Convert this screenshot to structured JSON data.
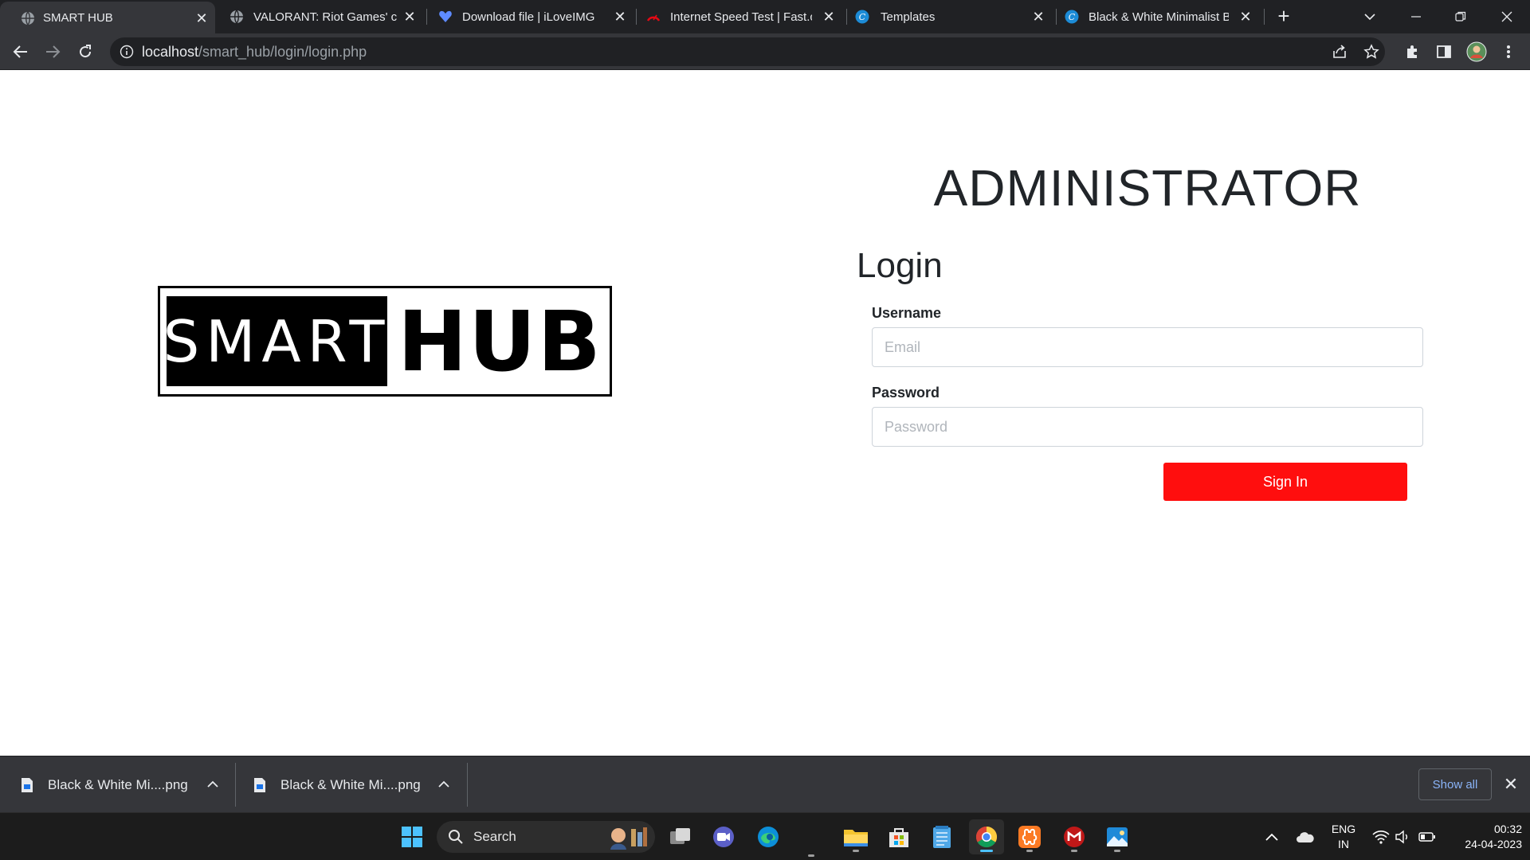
{
  "browser": {
    "tabs": [
      {
        "title": "SMART HUB",
        "active": true
      },
      {
        "title": "VALORANT: Riot Games' co"
      },
      {
        "title": "Download file | iLoveIMG"
      },
      {
        "title": "Internet Speed Test | Fast.co"
      },
      {
        "title": "Templates"
      },
      {
        "title": "Black & White Minimalist B"
      }
    ],
    "address": {
      "host": "localhost",
      "path": "/smart_hub/login/login.php"
    }
  },
  "page": {
    "logo": {
      "left_text": "SMART",
      "right_text": "HUB"
    },
    "admin_heading": "ADMINISTRATOR",
    "login_heading": "Login",
    "form": {
      "username_label": "Username",
      "username_placeholder": "Email",
      "username_value": "",
      "password_label": "Password",
      "password_placeholder": "Password",
      "password_value": "",
      "submit_label": "Sign In"
    },
    "colors": {
      "accent": "#ff0e0e"
    }
  },
  "downloads": {
    "items": [
      {
        "name": "Black & White Mi....png"
      },
      {
        "name": "Black & White Mi....png"
      }
    ],
    "show_all": "Show all"
  },
  "taskbar": {
    "search_label": "Search",
    "language": {
      "line1": "ENG",
      "line2": "IN"
    },
    "time": "00:32",
    "date": "24-04-2023",
    "apps": [
      "task-view",
      "teams-meet",
      "edge",
      "file-explorer",
      "microsoft-store",
      "notepad",
      "chrome",
      "xampp",
      "mcafee",
      "photos"
    ]
  }
}
